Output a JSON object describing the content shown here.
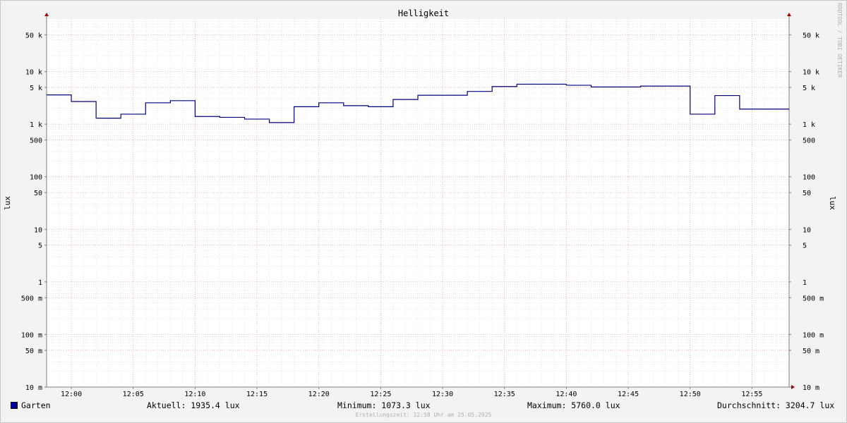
{
  "chart_data": {
    "type": "line",
    "title": "Helligkeit",
    "ylabel": "lux",
    "yscale": "log",
    "ylim": [
      0.01,
      100000
    ],
    "xlim": [
      "11:58",
      "12:58"
    ],
    "grid": true,
    "y_tick_labels": [
      "50 k",
      "10 k",
      "5 k",
      "1 k",
      "500",
      "100",
      "50",
      "10",
      "5",
      "1",
      "500 m",
      "100 m",
      "50 m",
      "10 m"
    ],
    "y_tick_values": [
      50000,
      10000,
      5000,
      1000,
      500,
      100,
      50,
      10,
      5,
      1,
      0.5,
      0.1,
      0.05,
      0.01
    ],
    "x_tick_labels": [
      "12:00",
      "12:05",
      "12:10",
      "12:15",
      "12:20",
      "12:25",
      "12:30",
      "12:35",
      "12:40",
      "12:45",
      "12:50",
      "12:55"
    ],
    "series": [
      {
        "name": "Garten",
        "color": "#00007f",
        "x": [
          "11:58",
          "12:00",
          "12:02",
          "12:04",
          "12:06",
          "12:08",
          "12:10",
          "12:12",
          "12:14",
          "12:16",
          "12:18",
          "12:20",
          "12:22",
          "12:24",
          "12:26",
          "12:28",
          "12:30",
          "12:32",
          "12:34",
          "12:36",
          "12:38",
          "12:40",
          "12:42",
          "12:44",
          "12:46",
          "12:48",
          "12:50",
          "12:52",
          "12:54",
          "12:56"
        ],
        "values": [
          3600,
          2700,
          1300,
          1550,
          2550,
          2800,
          1400,
          1350,
          1250,
          1073.3,
          2150,
          2550,
          2250,
          2150,
          2950,
          3550,
          3550,
          4200,
          5200,
          5760.0,
          5760.0,
          5500,
          5100,
          5100,
          5300,
          5300,
          1550,
          3500,
          1935.4,
          1935.4
        ],
        "end": "12:58"
      }
    ]
  },
  "legend": {
    "series_name": "Garten",
    "current": "Aktuell: 1935.4 lux",
    "minimum": "Minimum: 1073.3 lux",
    "maximum": "Maximum: 5760.0 lux",
    "average": "Durchschnitt: 3204.7 lux"
  },
  "footer": "Erstellungszeit: 12:58 Uhr am 25.05.2025",
  "watermark": "RRDTOOL / TOBI OETIKER"
}
